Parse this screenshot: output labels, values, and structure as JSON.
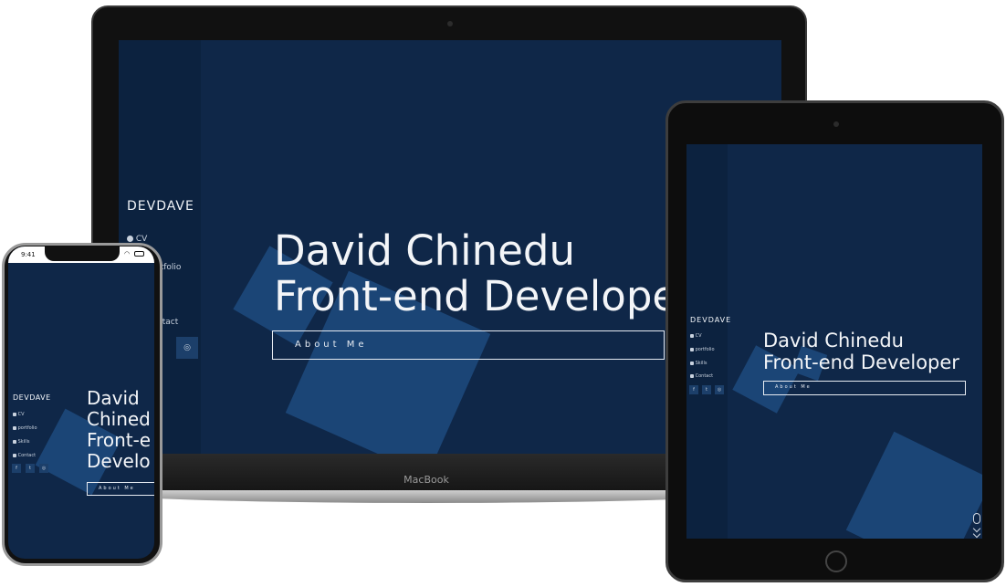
{
  "site": {
    "brand": "DEVDAVE",
    "hero_line1": "David Chinedu",
    "hero_line2": "Front-end Developer",
    "about_label": "About Me",
    "nav": [
      "CV",
      "portfolio",
      "Skills",
      "Contact"
    ]
  },
  "laptop": {
    "label": "MacBook",
    "hero_line2_visible": "Front-end Develope",
    "nav_visible": [
      "CV",
      "rtfolio",
      "ntact"
    ]
  },
  "phone": {
    "time": "9:41",
    "hero_lines": [
      "David",
      "Chined",
      "Front-e",
      "Develo"
    ]
  },
  "social": [
    "f",
    "t",
    "ig"
  ],
  "colors": {
    "site_bg": "#0f2748",
    "sidebar_bg": "#0c223f",
    "shape": "#1b4576",
    "text": "#f3f5f8"
  }
}
